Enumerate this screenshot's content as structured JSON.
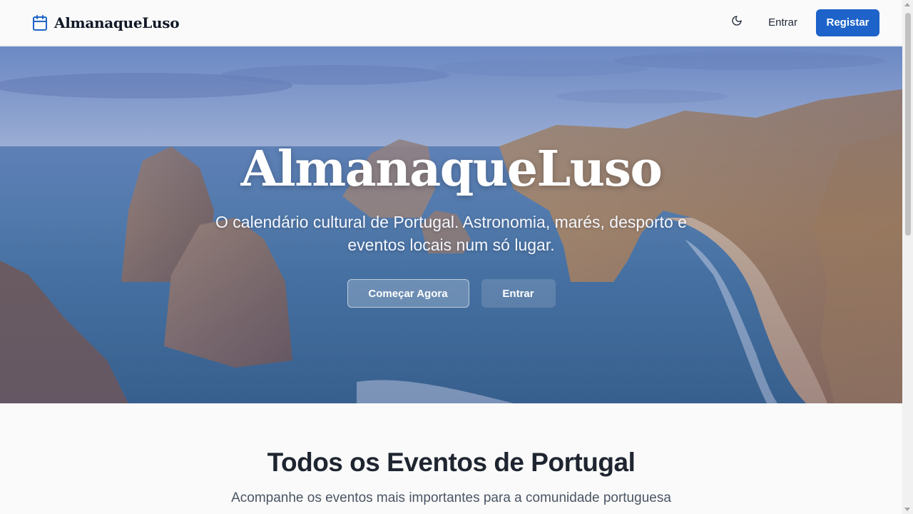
{
  "header": {
    "brand_name": "AlmanaqueLuso",
    "brand_icon": "calendar-icon",
    "theme_icon": "moon-icon",
    "login_label": "Entrar",
    "register_label": "Registar"
  },
  "hero": {
    "title": "AlmanaqueLuso",
    "subtitle": "O calendário cultural de Portugal. Astronomia, marés, desporto e eventos locais num só lugar.",
    "primary_button": "Começar Agora",
    "secondary_button": "Entrar"
  },
  "events": {
    "title": "Todos os Eventos de Portugal",
    "subtitle": "Acompanhe os eventos mais importantes para a comunidade portuguesa"
  },
  "colors": {
    "accent": "#1d63c9",
    "background": "#fafafa",
    "heading": "#1f2530"
  }
}
